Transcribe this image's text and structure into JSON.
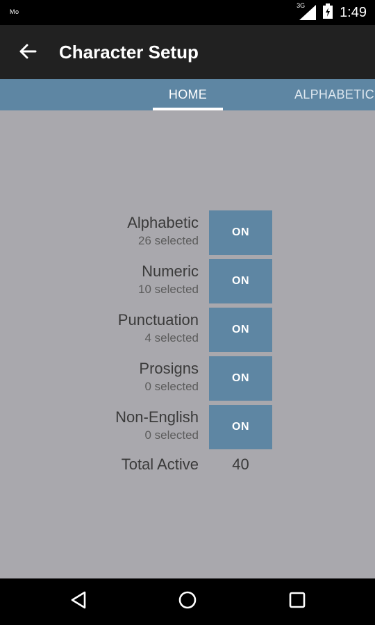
{
  "status_bar": {
    "carrier": "Mo",
    "network": "3G",
    "time": "1:49"
  },
  "app_bar": {
    "title": "Character Setup",
    "back_icon": "arrow-left-icon"
  },
  "tabs": [
    {
      "label": "HOME",
      "selected": true
    },
    {
      "label": "ALPHABETIC",
      "selected": false
    }
  ],
  "rows": [
    {
      "label": "Alphabetic",
      "sub": "26 selected",
      "toggle": "ON"
    },
    {
      "label": "Numeric",
      "sub": "10 selected",
      "toggle": "ON"
    },
    {
      "label": "Punctuation",
      "sub": "4 selected",
      "toggle": "ON"
    },
    {
      "label": "Prosigns",
      "sub": "0 selected",
      "toggle": "ON"
    },
    {
      "label": "Non-English",
      "sub": "0 selected",
      "toggle": "ON"
    }
  ],
  "total": {
    "label": "Total Active",
    "value": "40"
  },
  "nav_bar": {
    "back_icon": "triangle-back-icon",
    "home_icon": "circle-home-icon",
    "recents_icon": "square-recents-icon"
  },
  "colors": {
    "accent": "#5e86a3",
    "background": "#a9a8ad",
    "app_bar": "#212121"
  }
}
